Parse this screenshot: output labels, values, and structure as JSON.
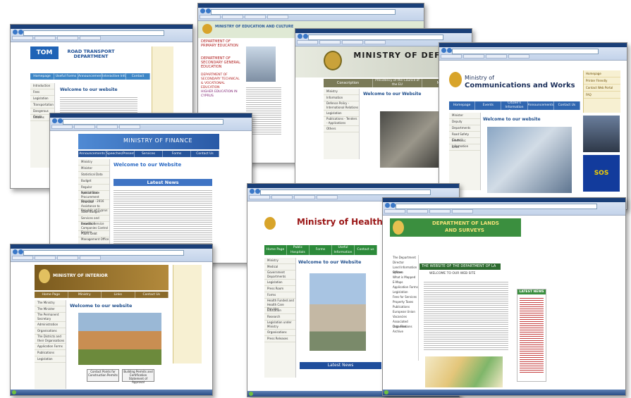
{
  "screens": {
    "road_transport": {
      "site_title": "ROAD TRANSPORT DEPARTMENT",
      "logo": "TOM",
      "welcome": "Welcome to our website",
      "nav": [
        "Homepage",
        "Useful Forms",
        "Announcements",
        "Interactive Information Guide",
        "Contact"
      ],
      "side": [
        "Introduction",
        "Fees",
        "Legislation",
        "Transportation",
        "Dangerous Goods",
        "Citizens"
      ]
    },
    "education": {
      "site_title": "MINISTRY OF EDUCATION AND CULTURE",
      "side": [
        "DEPARTMENT OF PRIMARY EDUCATION",
        "DEPARTMENT OF SECONDARY GENERAL EDUCATION",
        "DEPARTMENT OF SECONDARY TECHNICAL & VOCATIONAL EDUCATION",
        "HIGHER EDUCATION IN CYPRUS"
      ]
    },
    "defence": {
      "site_title": "MINISTRY OF DEFENCE",
      "nav": [
        "Conscription",
        "Presidency of the Council of the EU",
        "Multimedia"
      ],
      "welcome": "Welcome to our Website",
      "side": [
        "Ministry",
        "Information",
        "Defence Policy - International Relations",
        "Legislation",
        "Publications - Tenders - Applications",
        "Others"
      ]
    },
    "communications": {
      "site_title_line1": "Ministry of",
      "site_title_line2": "Communications and Works",
      "nav": [
        "Homepage",
        "Events",
        "Citizen's Information Service",
        "Announcements",
        "Contact Us"
      ],
      "welcome": "Welcome to our website",
      "side": [
        "Minister",
        "Deputy",
        "Departments",
        "Road Safety Council",
        "Electronic Information",
        "Links"
      ],
      "right": [
        "Homepage",
        "Printer Friendly",
        "Contact Web Portal",
        "FAQ"
      ],
      "sos": "SOS"
    },
    "finance": {
      "site_title": "MINISTRY OF FINANCE",
      "nav": [
        "Announcements",
        "Speeches/Presentations",
        "Services",
        "Forms",
        "Contact Us"
      ],
      "welcome": "Welcome to our Website",
      "latest_news": "Latest News",
      "side": [
        "Ministry",
        "Minister",
        "Statistical Data",
        "Budget",
        "Regular Publications",
        "Special State Procurement Standard - 2016",
        "Financial Assistance to Republic of Cyprus",
        "State Budget",
        "Services and Benefits Service",
        "Insurance Companies Control Service",
        "Public Debt Management Office"
      ]
    },
    "interior": {
      "site_title": "MINISTRY OF INTERIOR",
      "welcome": "Welcome to our website",
      "nav": [
        "Home Page",
        "Ministry",
        "Links",
        "Contact Us"
      ],
      "side": [
        "The Ministry",
        "The Minister",
        "The Permanent Secretary",
        "Administration",
        "Organisations",
        "The Districts and their Organisations",
        "Application Forms",
        "Publications",
        "Legislation"
      ],
      "buttons": [
        "Contact Points for Construction Permits",
        "Building Permits and Certification Statement of Approval"
      ]
    },
    "health": {
      "site_title": "Ministry of Health",
      "nav": [
        "Home Page",
        "Public Hospitals",
        "Forms",
        "Useful Information",
        "Contact us"
      ],
      "welcome": "Welcome to our Website",
      "latest_news": "Latest News",
      "side": [
        "Ministry",
        "Medical",
        "Government Departments",
        "Legislation",
        "Press Room",
        "Forms",
        "Health Funded and Health Care Provider",
        "Education",
        "Research",
        "Legislation under Ministry",
        "Organisations",
        "Press Releases"
      ]
    },
    "lands": {
      "site_title_line1": "DEPARTMENT OF LANDS",
      "site_title_line2": "AND SURVEYS",
      "heading": "THE WEBSITE OF THE DEPARTMENT OF LA",
      "sub": "WELCOME TO OUR WEB SITE",
      "latest_news": "LATEST NEWS",
      "side": [
        "The Department",
        "Director",
        "Land Information System",
        "Offices",
        "What is Mapped",
        "E-Maps",
        "Application Forms",
        "Legislation",
        "Fees for Services",
        "Property Taxes",
        "Publications",
        "European Union",
        "Vacancies",
        "Associated Organisations",
        "Data Files",
        "Archive"
      ]
    }
  },
  "colors": {
    "navy": "#1a3f78",
    "finance_blue": "#3f74c4",
    "health_green": "#2c8a3a",
    "lands_green": "#3b8f3f",
    "cyprus_gold": "#d8a42a"
  }
}
